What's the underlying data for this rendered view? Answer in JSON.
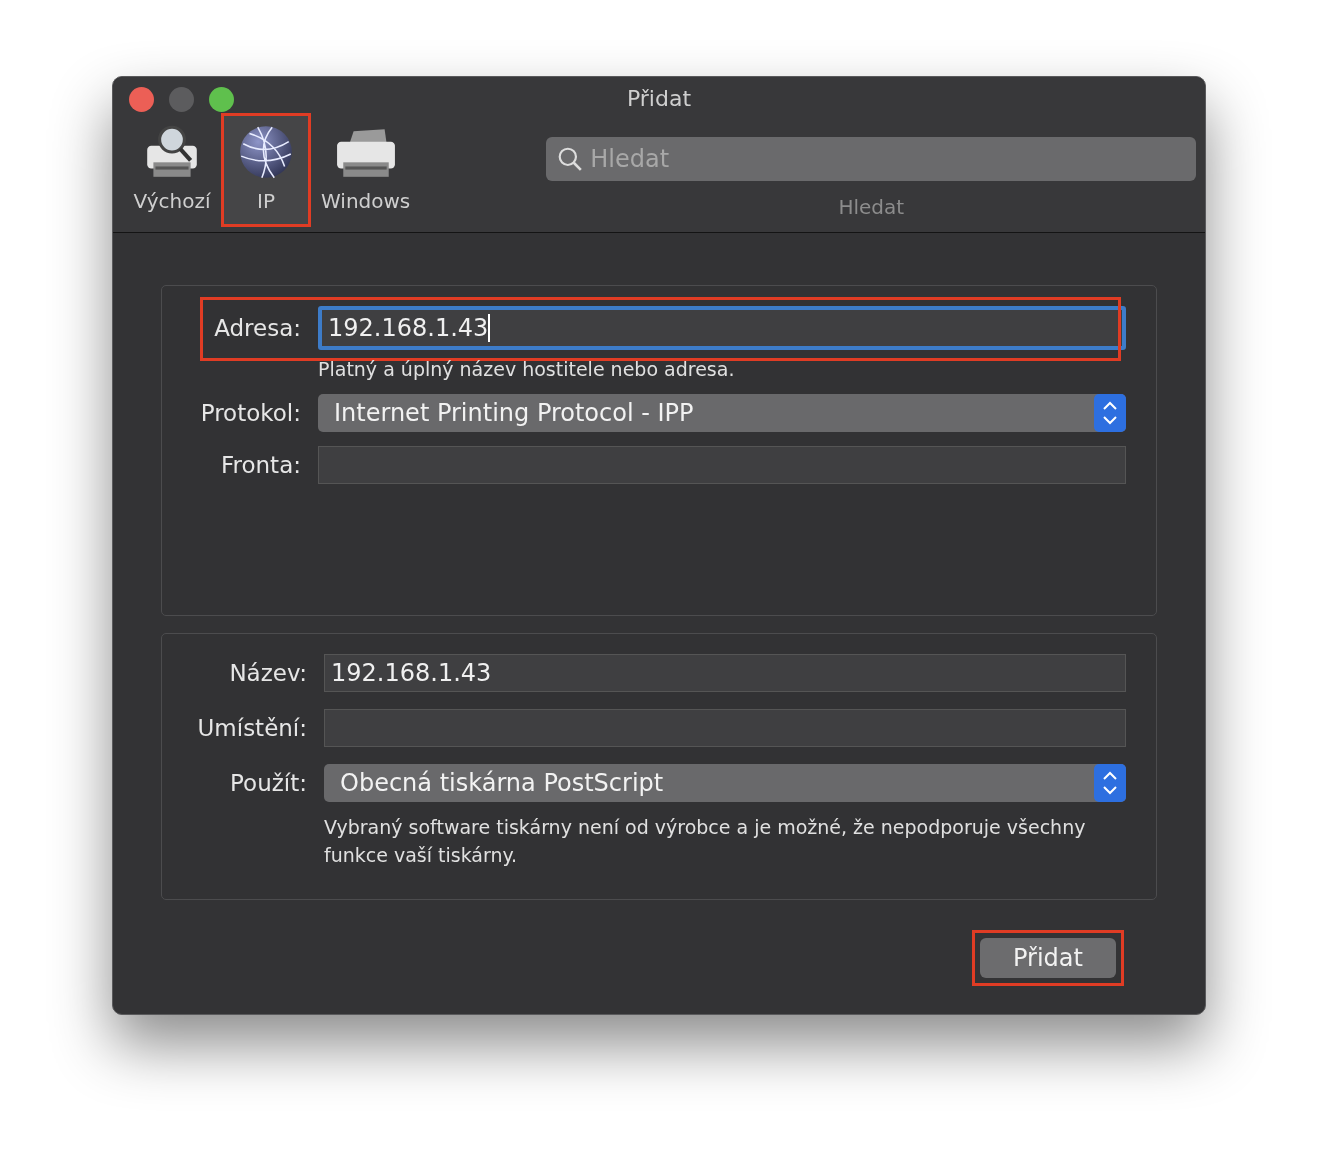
{
  "window": {
    "title": "Přidat"
  },
  "toolbar": [
    {
      "label": "Výchozí",
      "kind": "printer-search",
      "selected": false
    },
    {
      "label": "IP",
      "kind": "globe",
      "selected": true
    },
    {
      "label": "Windows",
      "kind": "printer",
      "selected": false
    }
  ],
  "search": {
    "placeholder": "Hledat",
    "caption": "Hledat"
  },
  "connection": {
    "address": {
      "label": "Adresa:",
      "value": "192.168.1.43",
      "focused": true
    },
    "hint": "Platný a úplný název hostitele nebo adresa.",
    "protocol": {
      "label": "Protokol:",
      "value": "Internet Printing Protocol - IPP"
    },
    "queue": {
      "label": "Fronta:"
    }
  },
  "printer": {
    "name": {
      "label": "Název:",
      "value": "192.168.1.43"
    },
    "location": {
      "label": "Umístění:"
    },
    "use": {
      "label": "Použít:",
      "value": "Obecná tiskárna PostScript"
    },
    "note": "Vybraný software tiskárny není od výrobce a je možné, že nepodporuje všechny funkce vaší tiskárny."
  },
  "add_button": "Přidat"
}
